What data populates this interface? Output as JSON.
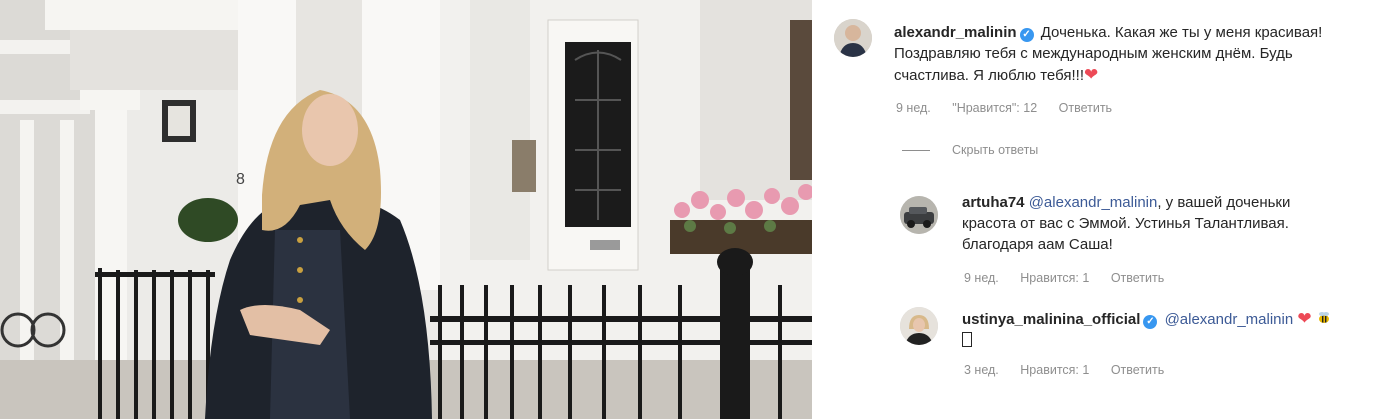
{
  "post_image": {
    "house_number": "8"
  },
  "comments": [
    {
      "username": "alexandr_malinin",
      "verified": true,
      "text_line1": "Доченька. Какая же ты у меня красивая!",
      "text_line2": "Поздравляю тебя с международным женским днём. Будь",
      "text_line3": "счастлива. Я люблю тебя!!!",
      "emoji": "heart",
      "time": "9 нед.",
      "likes": "\"Нравится\": 12",
      "reply_label": "Ответить"
    }
  ],
  "hide_replies_label": "Скрыть ответы",
  "replies": [
    {
      "username": "artuha74",
      "mention": "@alexandr_malinin",
      "text_first": ", у вашей доченьки",
      "text_line2": "красота от вас с Эммой. Устинья Талантливая.",
      "text_line3": "благодаря аам Саша!",
      "time": "9 нед.",
      "likes": "Нравится: 1",
      "reply_label": "Ответить"
    },
    {
      "username": "ustinya_malinina_official",
      "verified": true,
      "mention": "@alexandr_malinin",
      "emoji": [
        "heart",
        "bee",
        "unknown-glyph"
      ],
      "time": "3 нед.",
      "likes": "Нравится: 1",
      "reply_label": "Ответить"
    }
  ],
  "colors": {
    "heart": "#ed4956",
    "verified": "#3897f0",
    "mention": "#3c5a96",
    "meta": "#8e8e8e"
  }
}
